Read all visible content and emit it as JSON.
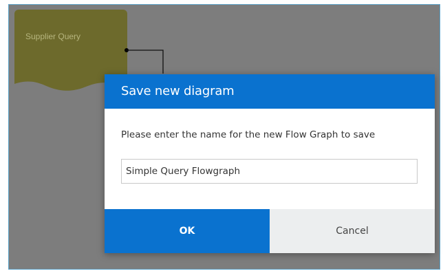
{
  "diagram": {
    "node": {
      "label": "Supplier Query",
      "color": "#6d6a2c"
    }
  },
  "dialog": {
    "title": "Save new diagram",
    "prompt": "Please enter the name for the new Flow Graph to save",
    "input_value": "Simple Query Flowgraph",
    "ok_label": "OK",
    "cancel_label": "Cancel",
    "accent_color": "#0a72cf"
  }
}
